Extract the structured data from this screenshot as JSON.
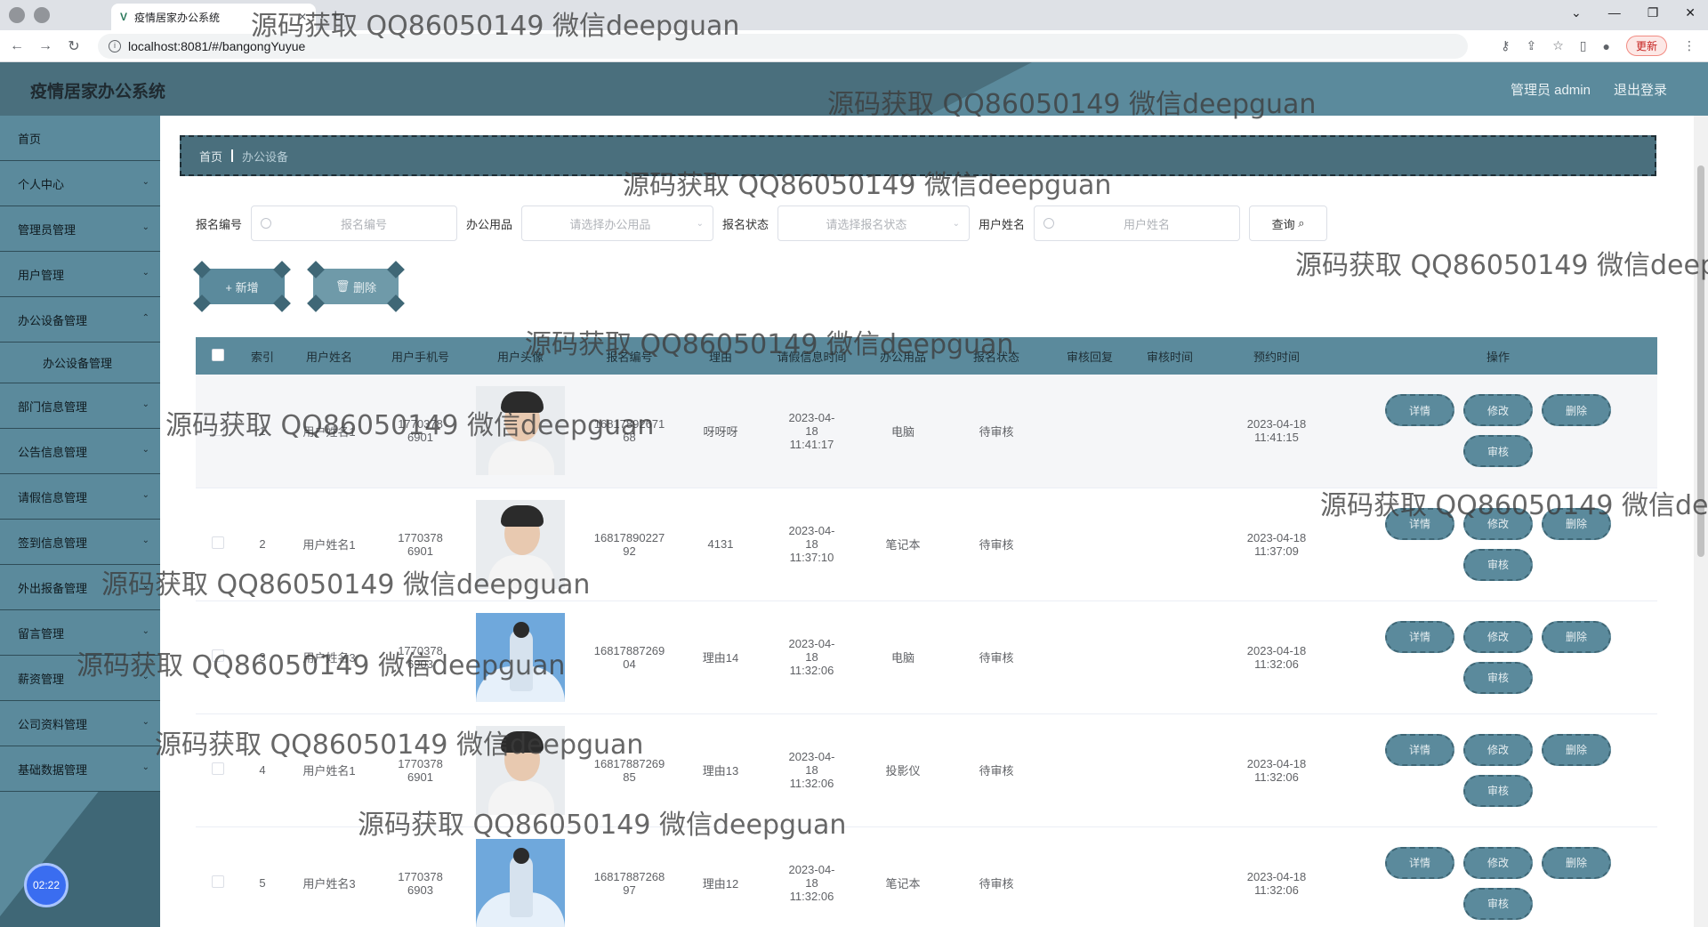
{
  "browser": {
    "tab_title": "疫情居家办公系统",
    "url": "localhost:8081/#/bangongYuyue",
    "update_label": "更新"
  },
  "header": {
    "title": "疫情居家办公系统",
    "user_label": "管理员 admin",
    "logout_label": "退出登录"
  },
  "sidebar": {
    "items": [
      {
        "label": "首页"
      },
      {
        "label": "个人中心"
      },
      {
        "label": "管理员管理"
      },
      {
        "label": "用户管理"
      },
      {
        "label": "办公设备管理"
      },
      {
        "label": "办公设备管理"
      },
      {
        "label": "部门信息管理"
      },
      {
        "label": "公告信息管理"
      },
      {
        "label": "请假信息管理"
      },
      {
        "label": "签到信息管理"
      },
      {
        "label": "外出报备管理"
      },
      {
        "label": "留言管理"
      },
      {
        "label": "薪资管理"
      },
      {
        "label": "公司资料管理"
      },
      {
        "label": "基础数据管理"
      }
    ],
    "clock": "02:22"
  },
  "breadcrumb": {
    "home": "首页",
    "current": "办公设备"
  },
  "search": {
    "fields": [
      {
        "label": "报名编号",
        "placeholder": "报名编号"
      },
      {
        "label": "办公用品",
        "placeholder": "请选择办公用品"
      },
      {
        "label": "报名状态",
        "placeholder": "请选择报名状态"
      },
      {
        "label": "用户姓名",
        "placeholder": "用户姓名"
      }
    ],
    "query_label": "查询"
  },
  "actions": {
    "add_label": "+ 新增",
    "delete_label": "删除"
  },
  "table": {
    "columns": [
      "索引",
      "用户姓名",
      "用户手机号",
      "用户头像",
      "报名编号",
      "理由",
      "请假信息时间",
      "办公用品",
      "报名状态",
      "审核回复",
      "审核时间",
      "预约时间",
      "操作"
    ],
    "rows": [
      {
        "index": "1",
        "name": "用户姓名1",
        "phone": "17703786901",
        "code": "1681789267168",
        "reason": "呀呀呀",
        "time": "2023-04-18 11:41:17",
        "item": "电脑",
        "status": "待审核",
        "reply": "",
        "audit_time": "",
        "reserve": "2023-04-18 11:41:15"
      },
      {
        "index": "2",
        "name": "用户姓名1",
        "phone": "17703786901",
        "code": "1681789022792",
        "reason": "4131",
        "time": "2023-04-18 11:37:10",
        "item": "笔记本",
        "status": "待审核",
        "reply": "",
        "audit_time": "",
        "reserve": "2023-04-18 11:37:09"
      },
      {
        "index": "3",
        "name": "用户姓名3",
        "phone": "17703786903",
        "code": "1681788726904",
        "reason": "理由14",
        "time": "2023-04-18 11:32:06",
        "item": "电脑",
        "status": "待审核",
        "reply": "",
        "audit_time": "",
        "reserve": "2023-04-18 11:32:06"
      },
      {
        "index": "4",
        "name": "用户姓名1",
        "phone": "17703786901",
        "code": "1681788726985",
        "reason": "理由13",
        "time": "2023-04-18 11:32:06",
        "item": "投影仪",
        "status": "待审核",
        "reply": "",
        "audit_time": "",
        "reserve": "2023-04-18 11:32:06"
      },
      {
        "index": "5",
        "name": "用户姓名3",
        "phone": "17703786903",
        "code": "1681788726897",
        "reason": "理由12",
        "time": "2023-04-18 11:32:06",
        "item": "笔记本",
        "status": "待审核",
        "reply": "",
        "audit_time": "",
        "reserve": "2023-04-18 11:32:06"
      }
    ],
    "op_labels": {
      "detail": "详情",
      "edit": "修改",
      "delete": "删除",
      "audit": "审核"
    }
  },
  "watermark": "源码获取 QQ86050149 微信deepguan"
}
